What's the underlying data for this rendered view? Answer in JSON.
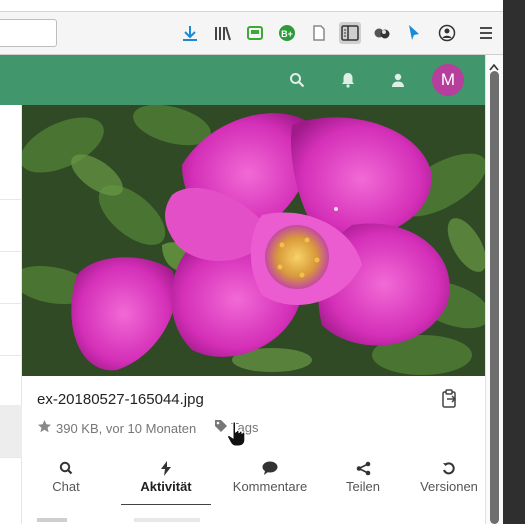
{
  "browser": {
    "toolbar_icons": [
      "download-icon",
      "library-icon",
      "screenshot-icon",
      "extension-b-icon",
      "reader-page-icon",
      "sidebar-icon",
      "circles-icon",
      "cursor-icon",
      "account-icon",
      "menu-icon"
    ]
  },
  "header": {
    "icons": [
      "search-icon",
      "bell-icon",
      "contacts-icon"
    ],
    "avatar_initial": "M",
    "avatar_color": "#b63e9c",
    "bar_color": "#41966b"
  },
  "file": {
    "name": "ex-20180527-165044.jpg",
    "size_age": "390 KB, vor 10 Monaten",
    "tags_label": "Tags"
  },
  "tabs": [
    {
      "label": "Chat",
      "icon": "search-icon"
    },
    {
      "label": "Aktivität",
      "icon": "lightning-icon",
      "active": true
    },
    {
      "label": "Kommentare",
      "icon": "comment-icon"
    },
    {
      "label": "Teilen",
      "icon": "share-icon"
    },
    {
      "label": "Versionen",
      "icon": "history-icon"
    }
  ]
}
